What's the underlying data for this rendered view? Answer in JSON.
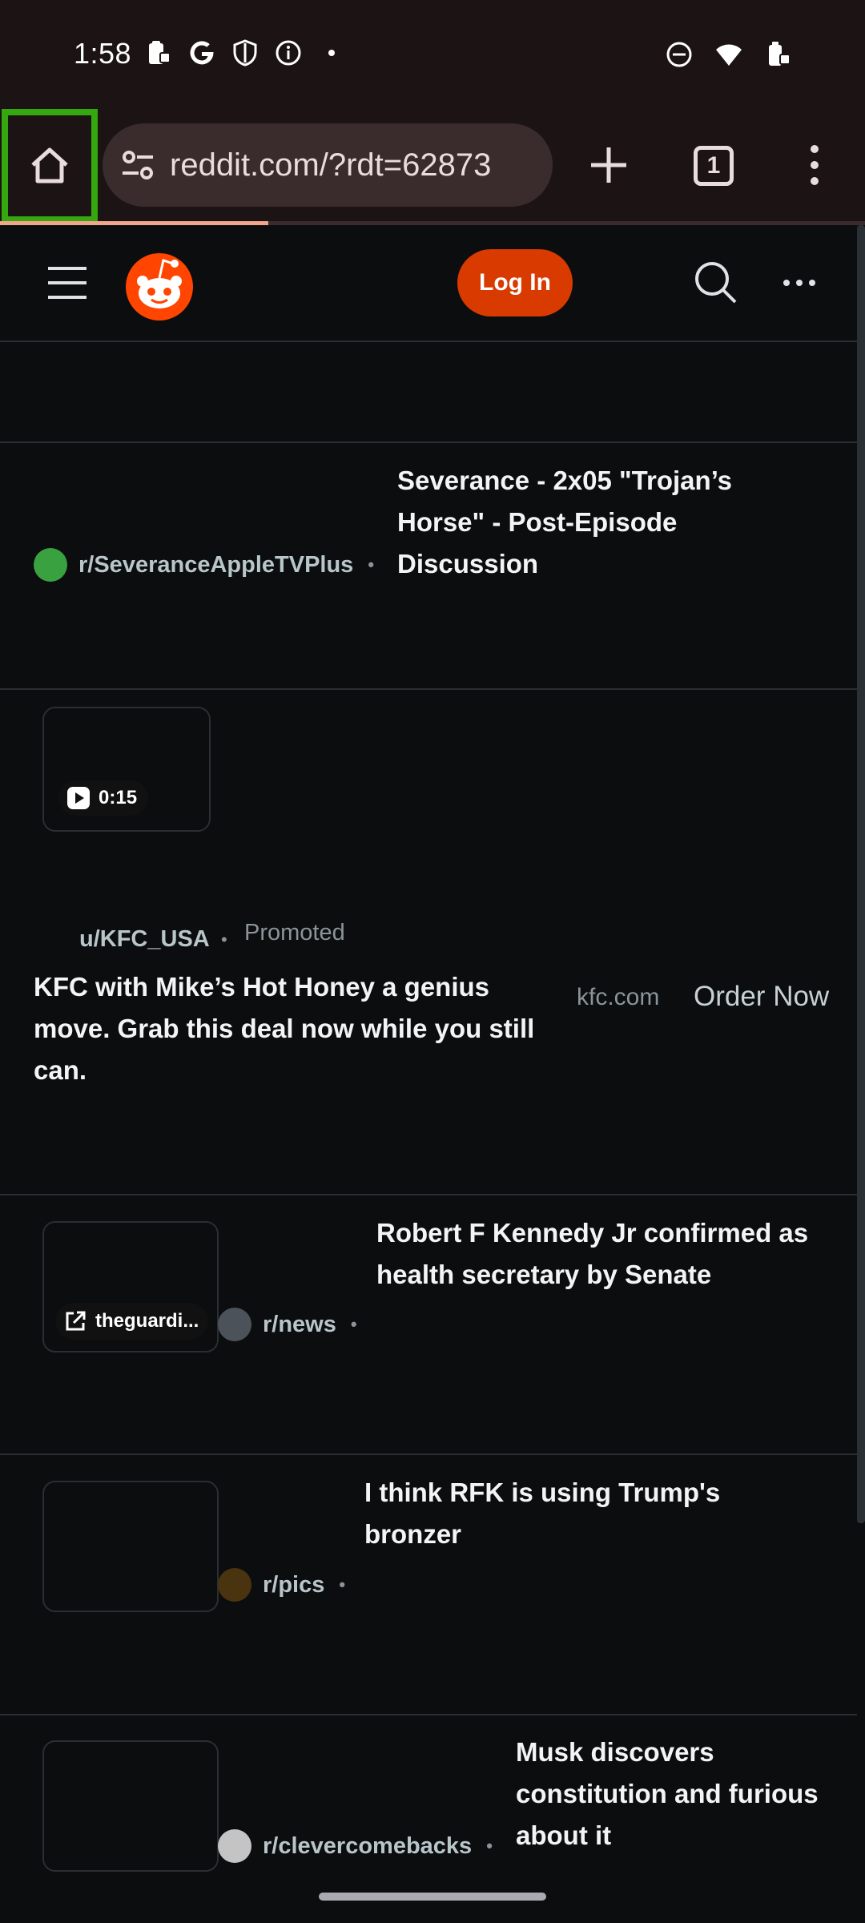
{
  "status_bar": {
    "time": "1:58"
  },
  "browser": {
    "url": "reddit.com/?rdt=62873",
    "tab_count": "1",
    "load_progress_fraction": 0.31
  },
  "header": {
    "login_label": "Log In"
  },
  "colors": {
    "accent": "#d93a00",
    "home_highlight": "#35a70f"
  },
  "posts": [
    {
      "subreddit": "r/SeveranceAppleTVPlus",
      "title_lines": [
        "Severance - 2x05 \"Trojan’s",
        "Horse\" - Post-Episode",
        "Discussion"
      ],
      "avatar_color": "#3aa140"
    },
    {
      "user": "u/KFC_USA",
      "promoted_label": "Promoted",
      "video_duration": "0:15",
      "title_lines": [
        "KFC with Mike’s Hot Honey a genius",
        "move. Grab this deal now while you still",
        "can."
      ],
      "domain": "kfc.com",
      "cta": "Order Now"
    },
    {
      "subreddit": "r/news",
      "link_label": "theguardi...",
      "title_lines": [
        "Robert F Kennedy Jr confirmed as",
        "health secretary by Senate"
      ],
      "avatar_color": "#4b5259"
    },
    {
      "subreddit": "r/pics",
      "title_lines": [
        "I think RFK is using Trump's",
        "bronzer"
      ],
      "avatar_color": "#4a3410"
    },
    {
      "subreddit": "r/clevercomebacks",
      "title_lines": [
        "Musk discovers",
        "constitution and furious",
        "about it"
      ],
      "avatar_color": "#c4c4c4"
    }
  ]
}
